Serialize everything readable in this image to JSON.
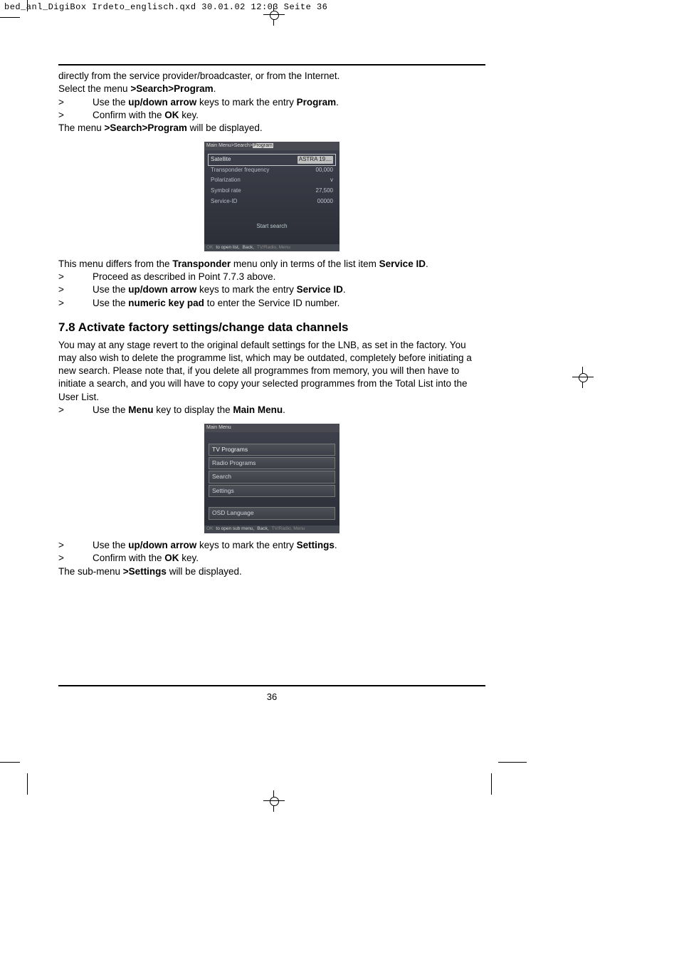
{
  "header": "bed_anl_DigiBox Irdeto_englisch.qxd  30.01.02  12:03  Seite 36",
  "intro1": "directly from the service provider/broadcaster, or from the Internet.",
  "intro2_pre": "Select the menu ",
  "intro2_bold": ">Search>Program",
  "intro2_post": ".",
  "b1_pre": "Use the ",
  "b1_b1": "up/down arrow",
  "b1_mid": " keys to mark the entry ",
  "b1_b2": "Program",
  "b1_post": ".",
  "b2_pre": "Confirm with the ",
  "b2_b": "OK",
  "b2_post": " key.",
  "after1_pre": "The menu ",
  "after1_b": ">Search>Program",
  "after1_post": " will be displayed.",
  "osd1": {
    "crumb_pre": "Main Menu>Search>",
    "crumb_hi": "Program",
    "rows": {
      "satellite_l": "Satellite",
      "satellite_v": "ASTRA 19....",
      "freq_l": "Transponder frequency",
      "freq_v": "00,000",
      "pol_l": "Polarization",
      "pol_v": "v",
      "sym_l": "Symbol rate",
      "sym_v": "27,500",
      "sid_l": "Service-ID",
      "sid_v": "00000"
    },
    "start": "Start search",
    "foot1": "OK",
    "foot2": "to open list,",
    "foot3": "Back,",
    "foot4": "TV/Radio, Menu"
  },
  "mid1_pre": "This menu differs from the ",
  "mid1_b1": "Transponder",
  "mid1_mid": " menu only in terms of the list item ",
  "mid1_b2": "Service ID",
  "mid1_post": ".",
  "b3": "Proceed as described in Point 7.7.3 above.",
  "b4_pre": "Use the ",
  "b4_b1": "up/down arrow",
  "b4_mid": " keys to mark the entry ",
  "b4_b2": "Service ID",
  "b4_post": ".",
  "b5_pre": "Use the ",
  "b5_b": "numeric key pad",
  "b5_post": " to enter the Service ID number.",
  "section": "7.8 Activate factory settings/change data channels",
  "para2": "You may at any stage revert to the original default settings for the LNB, as set in the factory. You may also wish to delete the programme list, which may be outdated, completely before initiating a new search. Please note that, if you delete all programmes from memory, you will then have to initiate a search, and you will have to copy your selected programmes from the Total List into the User List.",
  "b6_pre": "Use the ",
  "b6_b1": "Menu",
  "b6_mid": " key to display the ",
  "b6_b2": "Main Menu",
  "b6_post": ".",
  "osd2": {
    "crumb": "Main Menu",
    "items": {
      "tv": "TV Programs",
      "radio": "Radio Programs",
      "search": "Search",
      "settings": "Settings",
      "osd": "OSD Language"
    },
    "foot1": "OK",
    "foot2": "to open sub menu,",
    "foot3": "Back,",
    "foot4": "TV/Radio, Menu"
  },
  "b7_pre": "Use the ",
  "b7_b1": "up/down arrow",
  "b7_mid": " keys to mark the entry ",
  "b7_b2": "Settings",
  "b7_post": ".",
  "b8_pre": "Confirm with the ",
  "b8_b": "OK",
  "b8_post": " key.",
  "after2_pre": "The sub-menu ",
  "after2_b": ">Settings",
  "after2_post": " will be displayed.",
  "bullet": ">",
  "pagenum": "36"
}
